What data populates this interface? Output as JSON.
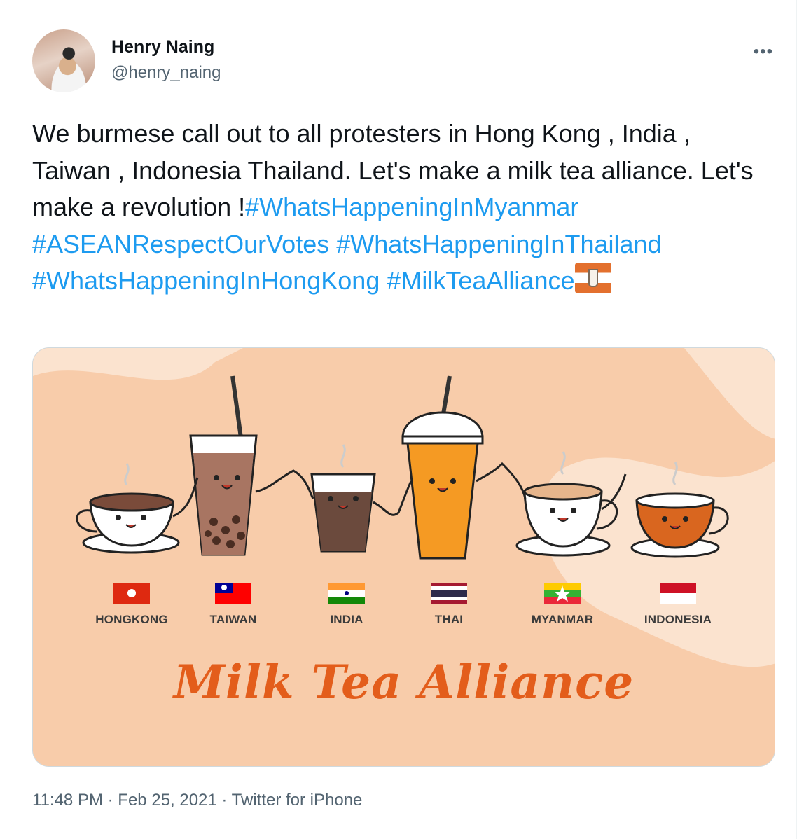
{
  "user": {
    "name": "Henry Naing",
    "handle": "@henry_naing",
    "more_icon": "more-horizontal-icon"
  },
  "tweet": {
    "text_plain": "We burmese call out to all protesters in Hong Kong , India , Taiwan , Indonesia Thailand. Let's make a milk tea alliance. Let's make a revolution !",
    "hashtags": [
      "#WhatsHappeningInMyanmar",
      "#ASEANRespectOurVotes",
      "#WhatsHappeningInThailand",
      "#WhatsHappeningInHongKong",
      "#MilkTeaAlliance"
    ],
    "emoji": "milk-tea-alliance-flag-emoji"
  },
  "media": {
    "countries": [
      "HONGKONG",
      "TAIWAN",
      "INDIA",
      "THAI",
      "MYANMAR",
      "INDONESIA"
    ],
    "banner": "Milk Tea Alliance"
  },
  "meta": {
    "time": "11:48 PM",
    "date": "Feb 25, 2021",
    "source": "Twitter for iPhone",
    "separator": "·"
  },
  "colors": {
    "link": "#1d9bf0",
    "secondary_text": "#536471",
    "banner_orange": "#e35d1b"
  }
}
